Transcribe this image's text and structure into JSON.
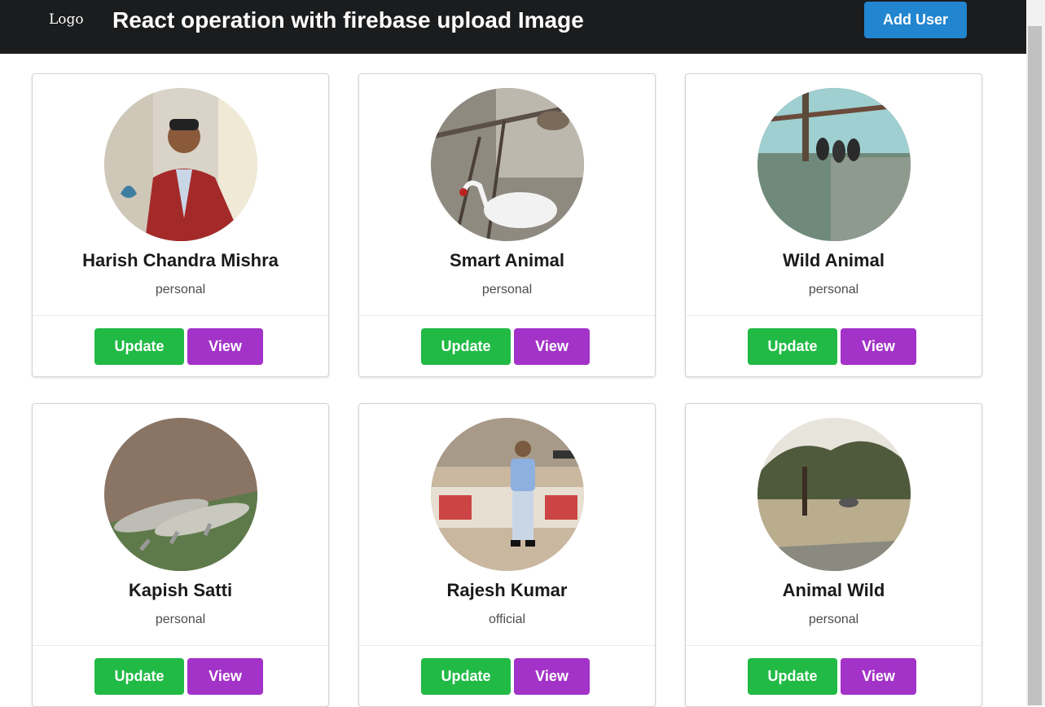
{
  "header": {
    "logo": "Logo",
    "title": "React operation with firebase upload Image",
    "add_user_label": "Add User"
  },
  "colors": {
    "navbar": "#1b1c1d",
    "add_user": "#2185d0",
    "update": "#21ba45",
    "view": "#a333c8"
  },
  "users": [
    {
      "name": "Harish Chandra Mishra",
      "category": "personal",
      "update_label": "Update",
      "view_label": "View"
    },
    {
      "name": "Smart Animal",
      "category": "personal",
      "update_label": "Update",
      "view_label": "View"
    },
    {
      "name": "Wild Animal",
      "category": "personal",
      "update_label": "Update",
      "view_label": "View"
    },
    {
      "name": "Kapish Satti",
      "category": "personal",
      "update_label": "Update",
      "view_label": "View"
    },
    {
      "name": "Rajesh Kumar",
      "category": "official",
      "update_label": "Update",
      "view_label": "View"
    },
    {
      "name": "Animal Wild",
      "category": "personal",
      "update_label": "Update",
      "view_label": "View"
    }
  ]
}
